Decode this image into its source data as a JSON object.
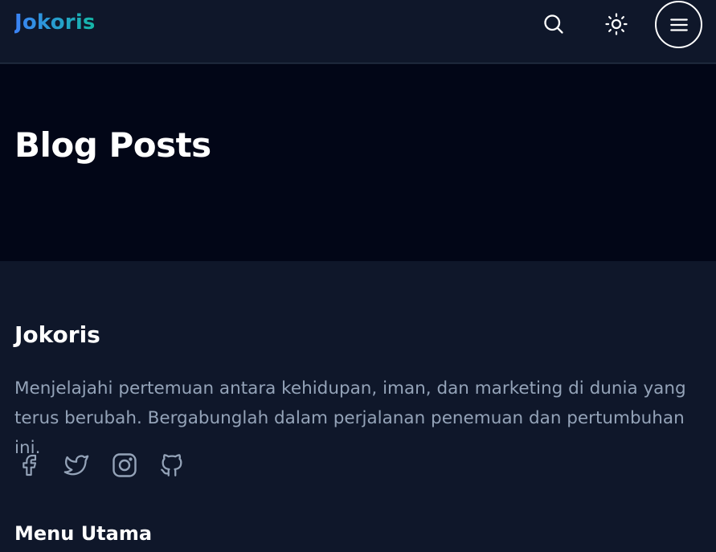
{
  "header": {
    "logo": "Jokoris",
    "icons": {
      "search": "search-icon",
      "theme": "sun-icon",
      "menu": "hamburger-menu-icon"
    }
  },
  "hero": {
    "title": "Blog Posts"
  },
  "footer": {
    "brand": "Jokoris",
    "description": "Menjelajahi pertemuan antara kehidupan, iman, dan marketing di dunia yang terus berubah. Bergabunglah dalam perjalanan penemuan dan pertumbuhan ini.",
    "social": [
      "facebook-icon",
      "twitter-icon",
      "instagram-icon",
      "github-icon"
    ],
    "menu_title": "Menu Utama"
  },
  "colors": {
    "background": "#0f172a",
    "hero_background": "#020617",
    "muted_text": "#94a3b8",
    "logo_gradient_start": "#3b82f6",
    "logo_gradient_end": "#14b8a6"
  }
}
